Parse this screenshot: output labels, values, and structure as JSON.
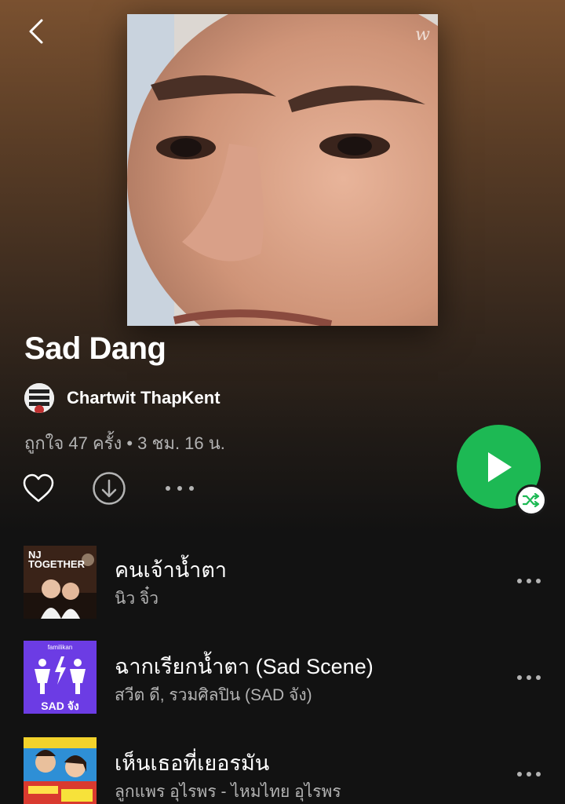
{
  "header": {
    "back_icon": "chevron-left-icon",
    "cover_watermark": "w"
  },
  "playlist": {
    "title": "Sad Dang",
    "owner": "Chartwit ThapKent",
    "owner_avatar_text": "ANTI SOCIAL SOCIAL CLUB",
    "meta": "ถูกใจ 47 ครั้ง • 3 ชม. 16 น."
  },
  "actions": {
    "like_icon": "heart-icon",
    "download_icon": "download-icon",
    "more_icon": "more-horizontal-icon",
    "play_icon": "play-icon",
    "shuffle_icon": "shuffle-icon",
    "accent_color": "#1db954"
  },
  "tracks": [
    {
      "title": "คนเจ้าน้ำตา",
      "artist": "นิว จิ๋ว",
      "art_text": "NJ TOGETHER",
      "art_color": "#2a1a14"
    },
    {
      "title": "ฉากเรียกน้ำตา (Sad Scene)",
      "artist": "สวีต ดี, รวมศิลปิน (SAD จัง)",
      "art_text": "SAD จัง",
      "art_top_text": "familikan",
      "art_color": "#6c3ce4"
    },
    {
      "title": "เห็นเธอที่เยอรมัน",
      "artist": "ลูกแพร อุไรพร - ไหมไทย อุไรพร",
      "art_color": "#c83a3a"
    }
  ]
}
